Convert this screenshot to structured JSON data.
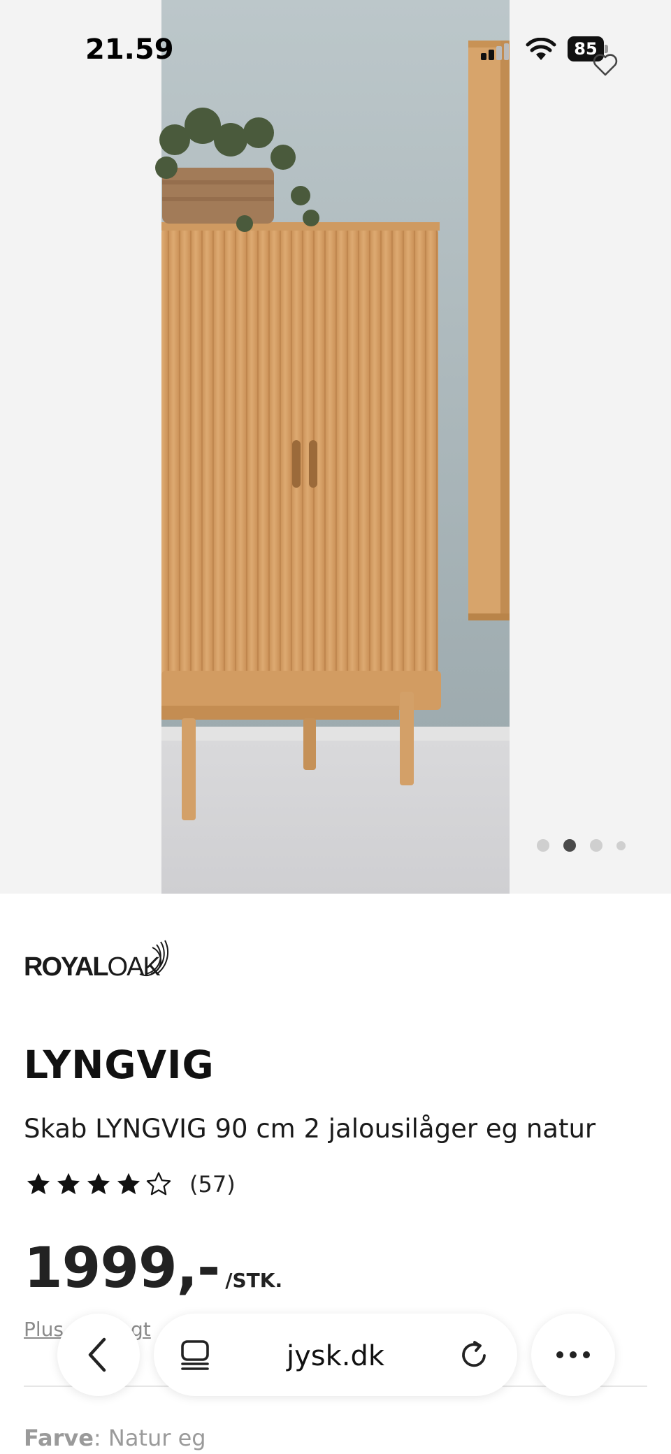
{
  "status_bar": {
    "time": "21.59",
    "battery": "85"
  },
  "product": {
    "brand": "ROYALOAK",
    "name": "LYNGVIG",
    "description": "Skab LYNGVIG 90 cm 2 jalousilåger eg natur",
    "rating": {
      "stars": 4,
      "max": 5,
      "count": "(57)"
    },
    "price": "1999,-",
    "price_unit": "/STK.",
    "plus_text_left": "Plus",
    "plus_text_right": "gt",
    "color_label": "Farve",
    "color_value": ": Natur eg"
  },
  "carousel": {
    "count": 4,
    "active_index": 1
  },
  "browser": {
    "url": "jysk.dk"
  },
  "icons": {
    "favorite": "heart-outline-icon",
    "back": "chevron-left-icon",
    "tabs": "tabs-icon",
    "reload": "reload-icon",
    "more": "more-horizontal-icon"
  },
  "colors": {
    "text": "#111111",
    "price": "#222222",
    "muted": "#8a8a8a",
    "dot_active": "#4a4a4a",
    "dot_inactive": "#cfcfcf",
    "wood": "#d9a66c",
    "wall": "#a3b1b4"
  }
}
